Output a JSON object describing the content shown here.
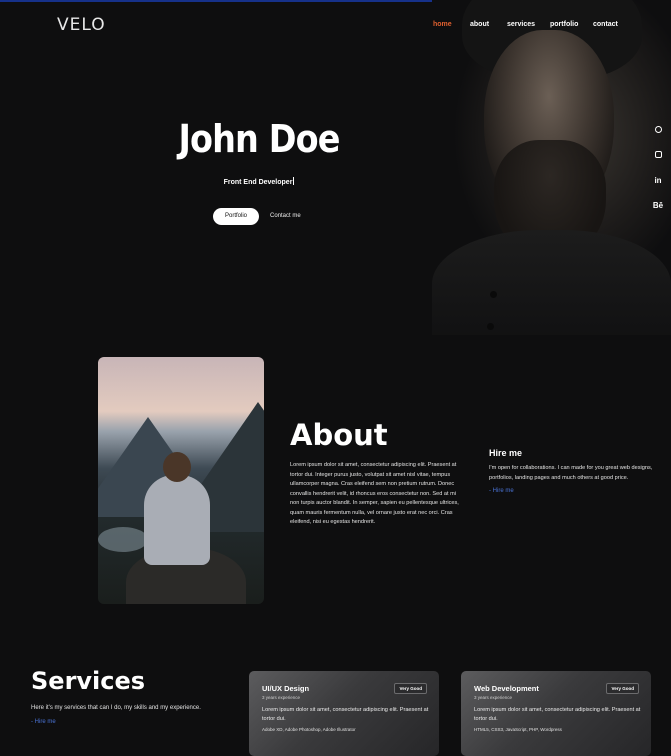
{
  "header": {
    "logo": "VELO",
    "nav": [
      "home",
      "about",
      "services",
      "portfolio",
      "contact"
    ],
    "active": "home",
    "accent": "#e0602f"
  },
  "hero": {
    "name": "John Doe",
    "role": "Front End Developer",
    "portfolio_button": "Portfolio",
    "contact_button": "Contact me"
  },
  "socials": [
    "dribbble-icon",
    "instagram-icon",
    "in",
    "Bē"
  ],
  "about": {
    "title": "About",
    "text": "Lorem ipsum dolor sit amet, consectetur adipiscing elit. Praesent at tortor dui. Integer purus justo, volutpat sit amet nisl vitae, tempus ullamcorper magna. Cras eleifend sem non pretium rutrum. Donec convallis hendrerit velit, id rhoncus eros consectetur non. Sed at mi non turpis auctor blandit. In semper, sapien eu pellentesque ultrices, quam mauris fermentum nulla, vel ornare justo erat nec orci. Cras eleifend, nisi eu egestas hendrerit.",
    "hire_title": "Hire me",
    "hire_text": "I'm open for collaborations. I can made for you great web designs, portfolios, landing pages and much others at good price.",
    "hire_link": "- Hire me",
    "link_color": "#4a73d6"
  },
  "services": {
    "title": "Services",
    "description": "Here it's my services that can I do, my skills and my experience.",
    "link": "- Hire me",
    "cards": [
      {
        "title": "UI/UX Design",
        "years": "3 years experience",
        "badge": "Very Good",
        "text": "Lorem ipsum dolor sit amet, consectetur adipiscing elit. Praesent at tortor dui.",
        "tags": "Adobe XD, Adobe Photoshop, Adobe Illustrator"
      },
      {
        "title": "Web Development",
        "years": "3 years experience",
        "badge": "Very Good",
        "text": "Lorem ipsum dolor sit amet, consectetur adipiscing elit. Praesent at tortor dui.",
        "tags": "HTML5, CSS3, JavaScript, PHP, Wordpress"
      }
    ]
  }
}
